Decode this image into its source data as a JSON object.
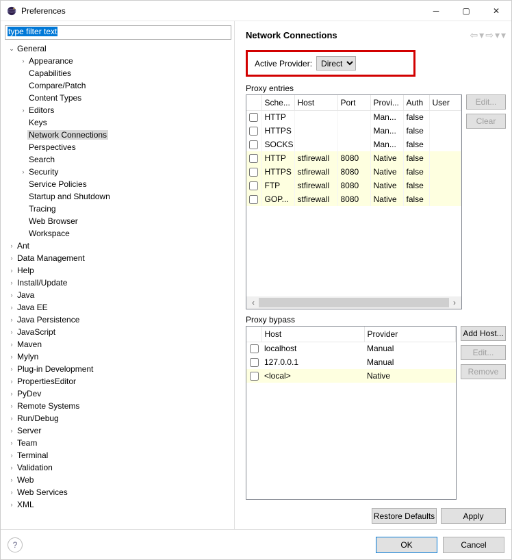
{
  "window": {
    "title": "Preferences"
  },
  "filter": {
    "placeholder": "type filter text"
  },
  "tree": {
    "general": {
      "label": "General",
      "children": [
        "Appearance",
        "Capabilities",
        "Compare/Patch",
        "Content Types",
        "Editors",
        "Keys",
        "Network Connections",
        "Perspectives",
        "Search",
        "Security",
        "Service Policies",
        "Startup and Shutdown",
        "Tracing",
        "Web Browser",
        "Workspace"
      ],
      "expandable_children_indexes": [
        0,
        4,
        9
      ],
      "selected_index": 6
    },
    "top": [
      "Ant",
      "Data Management",
      "Help",
      "Install/Update",
      "Java",
      "Java EE",
      "Java Persistence",
      "JavaScript",
      "Maven",
      "Mylyn",
      "Plug-in Development",
      "PropertiesEditor",
      "PyDev",
      "Remote Systems",
      "Run/Debug",
      "Server",
      "Team",
      "Terminal",
      "Validation",
      "Web",
      "Web Services",
      "XML"
    ]
  },
  "page": {
    "title": "Network Connections",
    "active_provider_label": "Active Provider:",
    "active_provider_value": "Direct",
    "proxy_entries_label": "Proxy entries",
    "proxy_bypass_label": "Proxy bypass",
    "entries_columns": [
      "Sche...",
      "Host",
      "Port",
      "Provi...",
      "Auth",
      "User"
    ],
    "entries": [
      {
        "scheme": "HTTP",
        "host": "",
        "port": "",
        "provider": "Man...",
        "auth": "false",
        "user": "",
        "native": false
      },
      {
        "scheme": "HTTPS",
        "host": "",
        "port": "",
        "provider": "Man...",
        "auth": "false",
        "user": "",
        "native": false
      },
      {
        "scheme": "SOCKS",
        "host": "",
        "port": "",
        "provider": "Man...",
        "auth": "false",
        "user": "",
        "native": false
      },
      {
        "scheme": "HTTP",
        "host": "stfirewall",
        "port": "8080",
        "provider": "Native",
        "auth": "false",
        "user": "",
        "native": true
      },
      {
        "scheme": "HTTPS",
        "host": "stfirewall",
        "port": "8080",
        "provider": "Native",
        "auth": "false",
        "user": "",
        "native": true
      },
      {
        "scheme": "FTP",
        "host": "stfirewall",
        "port": "8080",
        "provider": "Native",
        "auth": "false",
        "user": "",
        "native": true
      },
      {
        "scheme": "GOP...",
        "host": "stfirewall",
        "port": "8080",
        "provider": "Native",
        "auth": "false",
        "user": "",
        "native": true
      }
    ],
    "bypass_columns": [
      "Host",
      "Provider"
    ],
    "bypass": [
      {
        "host": "localhost",
        "provider": "Manual",
        "native": false
      },
      {
        "host": "127.0.0.1",
        "provider": "Manual",
        "native": false
      },
      {
        "host": "<local>",
        "provider": "Native",
        "native": true
      }
    ],
    "buttons": {
      "edit": "Edit...",
      "clear": "Clear",
      "add_host": "Add Host...",
      "remove": "Remove",
      "restore_defaults": "Restore Defaults",
      "apply": "Apply",
      "ok": "OK",
      "cancel": "Cancel"
    }
  }
}
